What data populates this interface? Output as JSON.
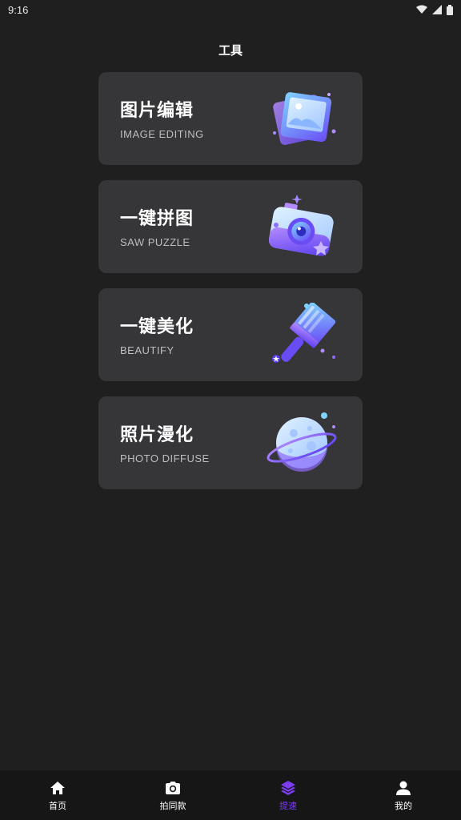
{
  "status_bar": {
    "time": "9:16"
  },
  "header": {
    "title": "工具"
  },
  "tools": [
    {
      "title": "图片编辑",
      "subtitle": "IMAGE EDITING",
      "icon": "photo-gallery-icon"
    },
    {
      "title": "一键拼图",
      "subtitle": "SAW PUZZLE",
      "icon": "camera-icon"
    },
    {
      "title": "一键美化",
      "subtitle": "BEAUTIFY",
      "icon": "paint-brush-icon"
    },
    {
      "title": "照片漫化",
      "subtitle": "PHOTO DIFFUSE",
      "icon": "planet-icon"
    }
  ],
  "tab_bar": {
    "items": [
      {
        "label": "首页",
        "icon": "home-icon",
        "active": false
      },
      {
        "label": "拍同款",
        "icon": "camera-icon",
        "active": false
      },
      {
        "label": "提速",
        "icon": "layers-icon",
        "active": true
      },
      {
        "label": "我的",
        "icon": "user-icon",
        "active": false
      }
    ]
  },
  "colors": {
    "background": "#1f1f1f",
    "card": "#363538",
    "accent": "#7b3cf2",
    "subtitle": "#bdbdc2"
  }
}
